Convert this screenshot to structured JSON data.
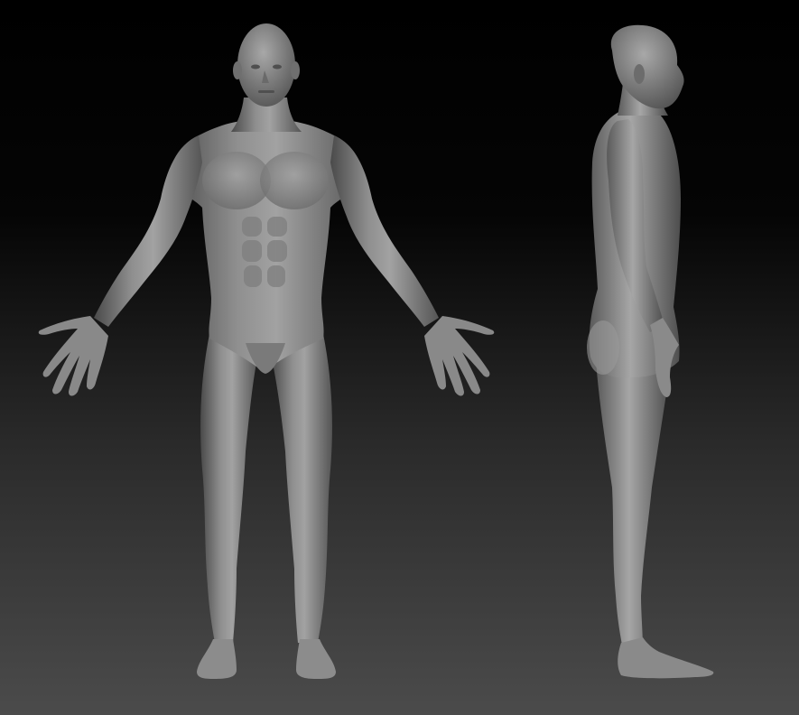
{
  "scene": {
    "background": {
      "top_color": "#000000",
      "bottom_color": "#4b4b4b"
    },
    "model": {
      "material_color": "#8a8a8a",
      "highlight_color": "#b8b8b8",
      "shadow_color": "#3c3c3c"
    }
  }
}
